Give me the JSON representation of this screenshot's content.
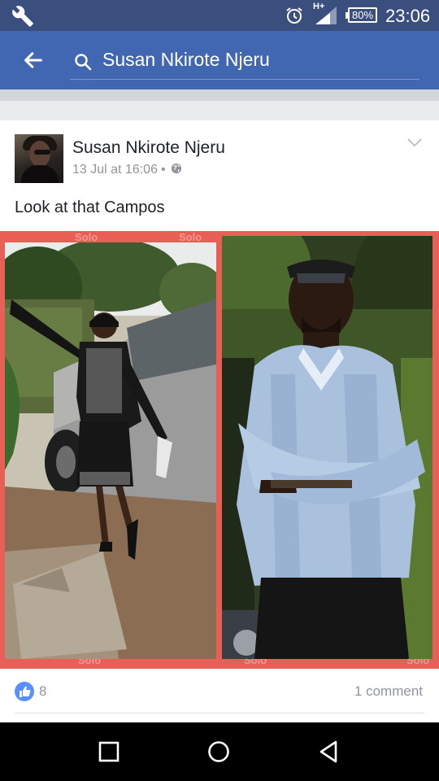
{
  "status_bar": {
    "network_type": "H+",
    "battery_percent": "80%",
    "time": "23:06",
    "icons": [
      "wrench-icon",
      "alarm-clock-icon",
      "cell-signal-icon",
      "battery-icon"
    ]
  },
  "app_bar": {
    "search_query": "Susan Nkirote Njeru",
    "icons": [
      "back-arrow-icon",
      "search-icon"
    ],
    "background_color": "#4267b2"
  },
  "post": {
    "author": "Susan Nkirote Njeru",
    "date": "13 Jul at 16:06",
    "meta_separator": "•",
    "privacy_icon": "globe-icon",
    "text": "Look at that Campos",
    "photo": {
      "frame_color": "#e86055",
      "watermark": "Solo"
    },
    "reactions": {
      "like_count": "8",
      "like_icon": "thumbs-up-icon",
      "like_color": "#5890ff"
    },
    "comment_count": "1 comment"
  },
  "nav_bar": {
    "buttons": [
      "recent-apps-icon",
      "home-icon",
      "back-triangle-icon"
    ]
  }
}
